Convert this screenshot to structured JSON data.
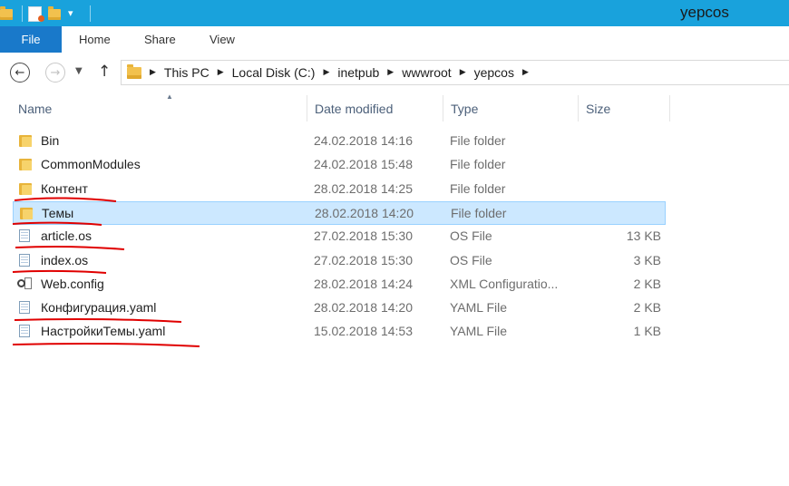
{
  "window": {
    "title": "yepcos"
  },
  "quick_access": {
    "dropdown_glyph": "▾"
  },
  "ribbon": {
    "tabs": [
      {
        "label": "File"
      },
      {
        "label": "Home"
      },
      {
        "label": "Share"
      },
      {
        "label": "View"
      }
    ]
  },
  "nav": {
    "back_glyph": "←",
    "forward_glyph": "→",
    "recent_glyph": "▼",
    "up_glyph": "↑"
  },
  "address": {
    "separator": "▶",
    "breadcrumbs": [
      "This PC",
      "Local Disk (C:)",
      "inetpub",
      "wwwroot",
      "yepcos"
    ]
  },
  "columns": {
    "name": "Name",
    "date": "Date modified",
    "type": "Type",
    "size": "Size",
    "sort_glyph": "▲"
  },
  "files": [
    {
      "name": "Bin",
      "date": "24.02.2018 14:16",
      "type": "File folder",
      "size": "",
      "icon": "folder-icon"
    },
    {
      "name": "CommonModules",
      "date": "24.02.2018 15:48",
      "type": "File folder",
      "size": "",
      "icon": "folder-icon"
    },
    {
      "name": "Контент",
      "date": "28.02.2018 14:25",
      "type": "File folder",
      "size": "",
      "icon": "folder-icon"
    },
    {
      "name": "Темы",
      "date": "28.02.2018 14:20",
      "type": "File folder",
      "size": "",
      "icon": "folder-icon",
      "selected": true
    },
    {
      "name": "article.os",
      "date": "27.02.2018 15:30",
      "type": "OS File",
      "size": "13 KB",
      "icon": "file-icon"
    },
    {
      "name": "index.os",
      "date": "27.02.2018 15:30",
      "type": "OS File",
      "size": "3 KB",
      "icon": "file-icon"
    },
    {
      "name": "Web.config",
      "date": "28.02.2018 14:24",
      "type": "XML Configuratio...",
      "size": "2 KB",
      "icon": "config-file-icon"
    },
    {
      "name": "Конфигурация.yaml",
      "date": "28.02.2018 14:20",
      "type": "YAML File",
      "size": "2 KB",
      "icon": "file-icon"
    },
    {
      "name": "НастройкиТемы.yaml",
      "date": "15.02.2018 14:53",
      "type": "YAML File",
      "size": "1 KB",
      "icon": "file-icon"
    }
  ],
  "colors": {
    "titlebar": "#19a2dc",
    "file_tab": "#1979ca",
    "selection": "#cce8ff",
    "annotation": "#e00000"
  }
}
